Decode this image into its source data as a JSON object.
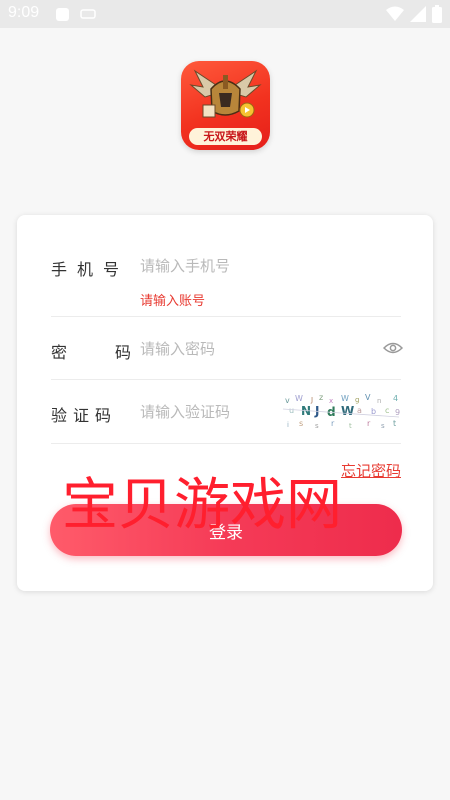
{
  "status_bar": {
    "time": "9:09"
  },
  "app_logo": {
    "banner_text": "无双荣耀"
  },
  "login_form": {
    "phone": {
      "label": "手机号",
      "placeholder": "请输入手机号",
      "error": "请输入账号"
    },
    "password": {
      "label": "密码",
      "placeholder": "请输入密码"
    },
    "captcha": {
      "label": "验证码",
      "placeholder": "请输入验证码"
    },
    "forgot_password": "忘记密码",
    "login_button": "登录"
  },
  "watermark": "宝贝游戏网",
  "colors": {
    "accent_red": "#e83b32",
    "button_gradient_start": "#ff5b6a",
    "button_gradient_end": "#ee2c4c"
  },
  "icons": {
    "eye": "eye-icon",
    "wifi": "wifi-icon",
    "signal": "signal-icon",
    "battery": "battery-icon"
  }
}
